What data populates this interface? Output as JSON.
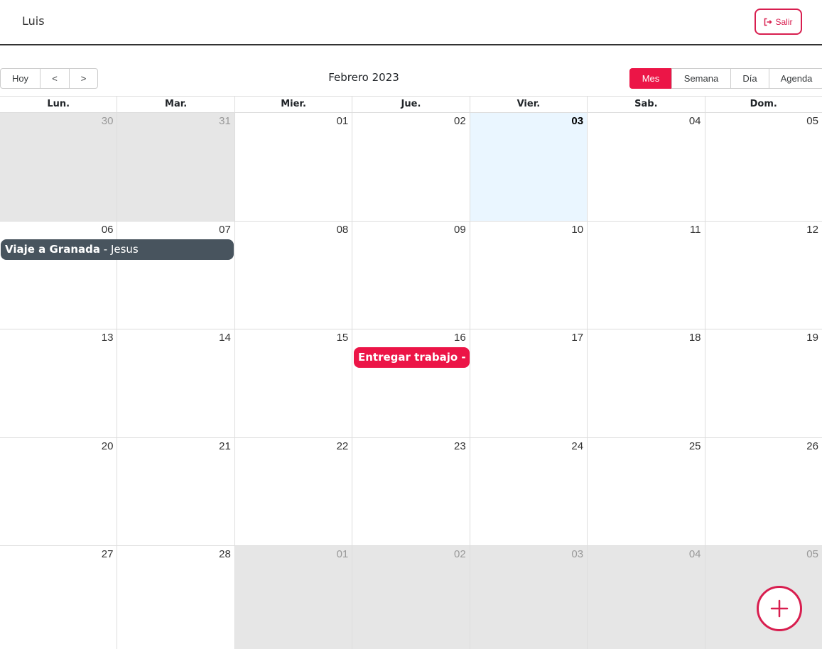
{
  "navbar": {
    "user_name": "Luis",
    "logout_label": "Salir",
    "logout_icon": "sign-out-icon"
  },
  "toolbar": {
    "today_label": "Hoy",
    "prev_label": "<",
    "next_label": ">",
    "current_label": "Febrero 2023",
    "views": [
      "Mes",
      "Semana",
      "Día",
      "Agenda"
    ],
    "active_view": "Mes"
  },
  "calendar": {
    "weekdays": [
      "Lun.",
      "Mar.",
      "Mier.",
      "Jue.",
      "Vier.",
      "Sab.",
      "Dom."
    ],
    "weeks": [
      [
        "30",
        "31",
        "01",
        "02",
        "03",
        "04",
        "05"
      ],
      [
        "06",
        "07",
        "08",
        "09",
        "10",
        "11",
        "12"
      ],
      [
        "13",
        "14",
        "15",
        "16",
        "17",
        "18",
        "19"
      ],
      [
        "20",
        "21",
        "22",
        "23",
        "24",
        "25",
        "26"
      ],
      [
        "27",
        "28",
        "01",
        "02",
        "03",
        "04",
        "05"
      ]
    ],
    "today": "03"
  },
  "events": [
    {
      "title": "Viaje a Granada",
      "separator": " - ",
      "person": "Jesus",
      "color": "#48545e"
    },
    {
      "title": "Entregar trabajo",
      "separator": " - ",
      "person": "",
      "color": "#ec1547"
    }
  ],
  "colors": {
    "accent": "#ec1547",
    "outline": "#d81e4f",
    "event_dark": "#48545e",
    "today_bg": "#eaf6ff",
    "off_range": "#e6e6e6"
  },
  "fab": {
    "icon": "plus-icon"
  }
}
